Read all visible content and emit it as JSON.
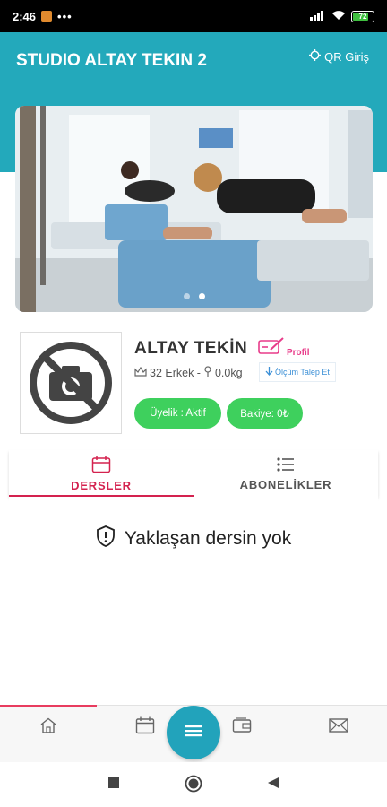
{
  "status_bar": {
    "time": "2:46",
    "dots": "•••",
    "battery": "72",
    "icons": [
      "app-notification-icon",
      "signal-icon",
      "wifi-icon",
      "battery-icon"
    ]
  },
  "header": {
    "title": "STUDIO ALTAY TEKIN 2",
    "qr_label": "QR Giriş",
    "background_color": "#23a9bb"
  },
  "banner": {
    "slide_count": 2,
    "active_slide": 2
  },
  "profile": {
    "name": "ALTAY TEKİN",
    "profile_link": "Profil",
    "age_gender": "32 Erkek -",
    "weight": "0.0kg",
    "measure_button": "Ölçüm Talep Et",
    "membership_pill": "Üyelik : Aktif",
    "balance_pill": "Bakiye: 0₺",
    "pill_color": "#3ed05d"
  },
  "tabs": [
    {
      "label": "DERSLER",
      "icon": "calendar-icon",
      "active": true
    },
    {
      "label": "ABONELİKLER",
      "icon": "list-icon",
      "active": false
    }
  ],
  "content": {
    "empty_message": "Yaklaşan dersin yok"
  },
  "bottom_nav": {
    "items": [
      "home-icon",
      "calendar-icon",
      "menu-icon",
      "wallet-icon",
      "mail-icon"
    ],
    "accent_color": "#e83c5f",
    "fab_color": "#22a3bb"
  },
  "system_nav": [
    "square-icon",
    "circle-icon",
    "back-triangle-icon"
  ]
}
